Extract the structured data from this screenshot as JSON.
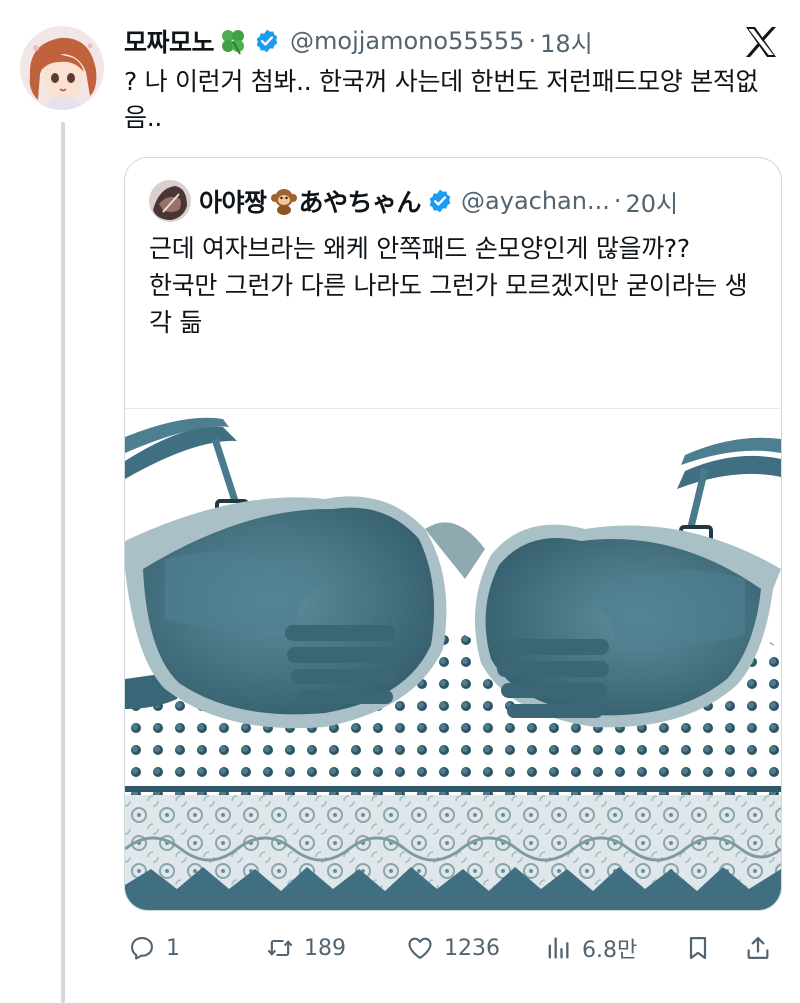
{
  "tweet": {
    "display_name": "모짜모노",
    "name_emoji": "clover-icon",
    "handle": "@mojjamono55555",
    "dot": "·",
    "time": "18시",
    "text": "? 나 이런거 첨봐.. 한국꺼 사는데 한번도 저런패드모양 본적없음..",
    "verified": true
  },
  "quote": {
    "display_name": "아야짱",
    "name_emoji": "monkey-icon",
    "display_name_jp": "あやちゃん",
    "handle": "@ayachan...",
    "dot": "·",
    "time": "20시",
    "text_line1": "근데 여자브라는 왜케 안쪽패드 손모양인게 많을까??",
    "text_line2": "한국만 그런가 다른 나라도 그런가 모르겠지만 굳이라는 생각 듦",
    "verified": true
  },
  "actions": {
    "replies": "1",
    "retweets": "189",
    "likes": "1236",
    "views": "6.8만"
  },
  "colors": {
    "verified_blue": "#1d9bf0",
    "muted_text": "#536471",
    "thread_line": "#cfd9de",
    "bra_teal": "#3f6f80"
  }
}
